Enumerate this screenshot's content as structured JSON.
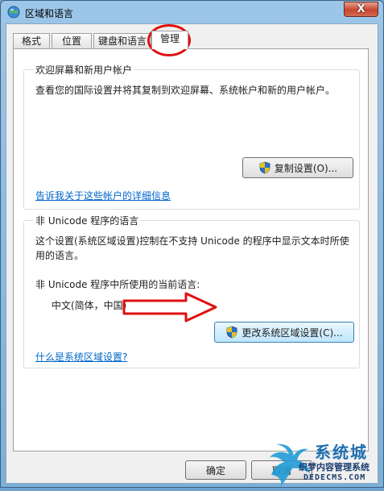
{
  "window": {
    "title": "区域和语言",
    "close_label": "X"
  },
  "tabs": [
    {
      "label": "格式"
    },
    {
      "label": "位置"
    },
    {
      "label": "键盘和语言"
    },
    {
      "label": "管理"
    }
  ],
  "welcome_group": {
    "title": "欢迎屏幕和新用户帐户",
    "description": "查看您的国际设置并将其复制到欢迎屏幕、系统帐户和新的用户帐户。",
    "copy_button": "复制设置(O)...",
    "link": "告诉我关于这些帐户的详细信息"
  },
  "unicode_group": {
    "title": "非 Unicode 程序的语言",
    "description_line1": "这个设置(系统区域设置)控制在不支持 Unicode 的程序中显示文本时所使",
    "description_line2": "用的语言。",
    "current_label": "非 Unicode 程序中所使用的当前语言:",
    "current_value": "中文(简体，中国)",
    "change_button": "更改系统区域设置(C)...",
    "link": "什么是系统区域设置?"
  },
  "footer": {
    "ok_button": "确定",
    "cancel_button": "取消"
  },
  "watermark": {
    "brand": "系统城",
    "site_name": "织梦内容管理系统",
    "url": "DEDECMS.COM"
  },
  "colors": {
    "annotation_red": "#e01010",
    "link_blue": "#0066cc"
  }
}
